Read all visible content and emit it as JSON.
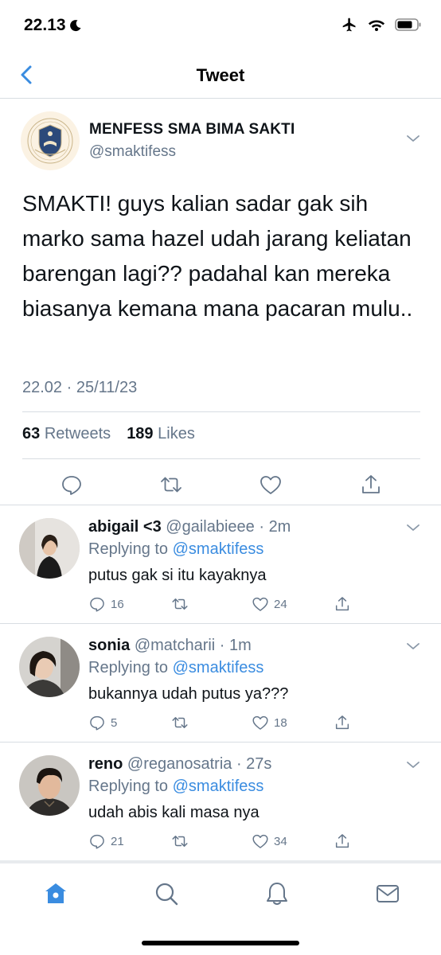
{
  "status_bar": {
    "time": "22.13"
  },
  "nav": {
    "title": "Tweet"
  },
  "tweet": {
    "author_name": "MENFESS SMA BIMA SAKTI",
    "author_handle": "@smaktifess",
    "logo_text": "BIMA SAKTI",
    "text": "SMAKTI! guys kalian sadar gak sih marko sama hazel udah jarang keliatan barengan lagi?? padahal kan mereka biasanya kemana mana pacaran mulu..",
    "timestamp": "22.02 · 25/11/23",
    "retweets_count": "63",
    "retweets_label": "Retweets",
    "likes_count": "189",
    "likes_label": "Likes"
  },
  "replies": [
    {
      "name": "abigail <3",
      "handle": "@gailabieee",
      "age": "2m",
      "replying_prefix": "Replying to",
      "replying_to": "@smaktifess",
      "text": "putus gak si itu kayaknya",
      "reply_count": "16",
      "retweet_count": "",
      "like_count": "24"
    },
    {
      "name": "sonia",
      "handle": "@matcharii",
      "age": "1m",
      "replying_prefix": "Replying to",
      "replying_to": "@smaktifess",
      "text": "bukannya udah putus ya???",
      "reply_count": "5",
      "retweet_count": "",
      "like_count": "18"
    },
    {
      "name": "reno",
      "handle": "@reganosatria",
      "age": "27s",
      "replying_prefix": "Replying to",
      "replying_to": "@smaktifess",
      "text": "udah abis kali masa nya",
      "reply_count": "21",
      "retweet_count": "",
      "like_count": "34"
    }
  ],
  "colors": {
    "accent": "#3a8ce0",
    "secondary_text": "#65768a",
    "primary_text": "#0f1419",
    "divider": "#d8dde2"
  },
  "icons": {
    "status": [
      "moon-icon",
      "airplane-icon",
      "wifi-icon",
      "battery-icon"
    ],
    "tweet_actions": [
      "reply-icon",
      "retweet-icon",
      "like-icon",
      "share-icon"
    ],
    "tabs": [
      "home-icon",
      "search-icon",
      "notifications-icon",
      "messages-icon"
    ]
  }
}
